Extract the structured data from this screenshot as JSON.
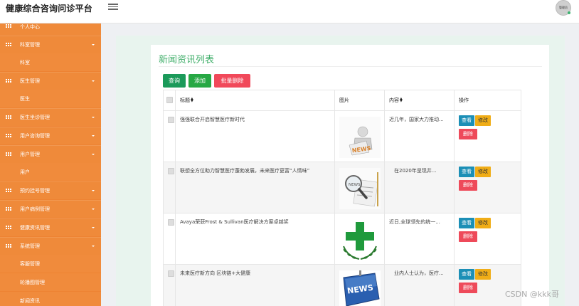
{
  "header": {
    "title": "健康综合咨询问诊平台",
    "avatar_text": "管理员"
  },
  "sidebar": {
    "items": [
      {
        "label": "个人中心",
        "type": "parent"
      },
      {
        "label": "科室管理",
        "type": "parent"
      },
      {
        "label": "科室",
        "type": "child"
      },
      {
        "label": "医生管理",
        "type": "parent"
      },
      {
        "label": "医生",
        "type": "child"
      },
      {
        "label": "医生坐诊管理",
        "type": "parent"
      },
      {
        "label": "用户咨询管理",
        "type": "parent"
      },
      {
        "label": "用户管理",
        "type": "parent"
      },
      {
        "label": "用户",
        "type": "child"
      },
      {
        "label": "预约挂号管理",
        "type": "parent"
      },
      {
        "label": "用户病例管理",
        "type": "parent"
      },
      {
        "label": "健康资讯管理",
        "type": "parent"
      },
      {
        "label": "系统管理",
        "type": "parent"
      },
      {
        "label": "客服管理",
        "type": "child"
      },
      {
        "label": "轮播图管理",
        "type": "child"
      },
      {
        "label": "新闻资讯",
        "type": "child"
      }
    ]
  },
  "panel": {
    "title": "新闻资讯列表",
    "buttons": {
      "query": "查询",
      "add": "添加",
      "batch_delete": "批量删除"
    }
  },
  "table": {
    "headers": {
      "title": "标题",
      "image": "图片",
      "content": "内容",
      "actions": "操作"
    },
    "rows": [
      {
        "title": "强强联合开启智慧医疗新时代",
        "image_icon": "news-man-icon",
        "content": "近几年，国家大力推动..."
      },
      {
        "title": "联想全方位助力智慧医疗蓬勃发展，未来医疗更富“人情味”",
        "image_icon": "news-magnifier-icon",
        "content": "　在2020年呈现井..."
      },
      {
        "title": "Avaya荣获Frost & Sullivan医疗解决方案卓越奖",
        "image_icon": "green-cross-icon",
        "content": "近日,全球领先的统一..."
      },
      {
        "title": "未来医疗新方向 区块链+大健康",
        "image_icon": "news-keyboard-icon",
        "content": "　业内人士认为，医疗..."
      }
    ],
    "actions": {
      "view": "查看",
      "edit": "修改",
      "delete": "删除"
    }
  },
  "watermark": "CSDN @kkk哥",
  "colors": {
    "sidebar": "#ee8333",
    "accent_green": "#3fae69",
    "danger": "#ee4a5a",
    "info": "#1c8fb6",
    "warning": "#f0ad17"
  }
}
